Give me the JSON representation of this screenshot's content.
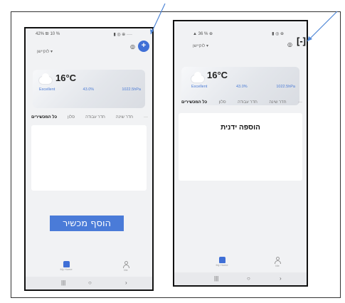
{
  "left_screen": {
    "status_left": "‪42% ₪ 10 %",
    "status_right": "▮ ◎ ⊕ ····",
    "location": "לוקיישן ▾",
    "weather": {
      "temperature": "16°C",
      "air_quality": "Excellent",
      "humidity": "43.0%",
      "pressure": "1022.5hPa"
    },
    "tabs": [
      "כל המכשירים",
      "סלון",
      "חדר עבודה",
      "חדר שינה",
      "···"
    ],
    "add_device_button": "הוסף מכשיר",
    "nav_home": "My Home",
    "nav_me": "Me",
    "sys_nav": [
      "|||",
      "○",
      "›"
    ]
  },
  "right_screen": {
    "status_left": "▲ 36 % ⊕",
    "status_right": "▮ ◎ ⊕",
    "location": "לוקיישן ▾",
    "weather": {
      "temperature": "16°C",
      "air_quality": "Excellent",
      "humidity": "43.0%",
      "pressure": "1022.5hPa"
    },
    "tabs": [
      "כל המכשירים",
      "סלון",
      "חדר עבודה",
      "חדר שינה",
      "···"
    ],
    "manual_add": "הוספה ידנית",
    "nav_home": "My Home",
    "nav_me": "Me",
    "sys_nav": [
      "|||",
      "○",
      "›"
    ]
  },
  "colors": {
    "accent": "#3f6fd6",
    "button": "#4a7bd8",
    "annotation": "#4f86d6"
  },
  "icons": {
    "plus": "plus-icon",
    "bracket": "bracket-button-icon"
  }
}
